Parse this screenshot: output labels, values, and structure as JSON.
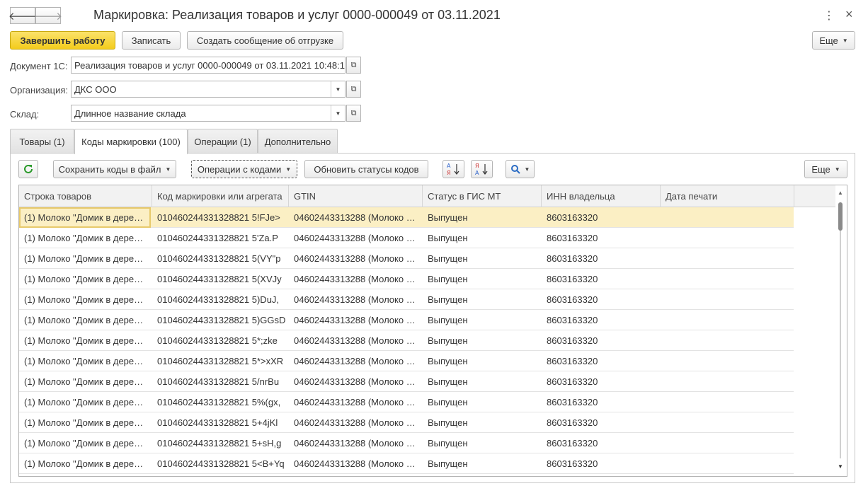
{
  "window": {
    "title": "Маркировка: Реализация товаров и услуг 0000-000049 от 03.11.2021",
    "back_icon": "back-arrow-icon",
    "forward_icon": "forward-arrow-icon",
    "menu_icon": "more-vertical-icon",
    "close_icon": "close-icon",
    "close_glyph": "×",
    "menu_glyph": "⋮"
  },
  "toolbar": {
    "finish_label": "Завершить работу",
    "save_label": "Записать",
    "create_message_label": "Создать сообщение об отгрузке",
    "more_label": "Еще"
  },
  "form": {
    "document_label": "Документ 1С:",
    "document_value": "Реализация товаров и услуг 0000-000049 от 03.11.2021 10:48:11",
    "organization_label": "Организация:",
    "organization_value": "ДКС ООО",
    "warehouse_label": "Склад:",
    "warehouse_value": "Длинное название склада"
  },
  "tabs": [
    {
      "label": "Товары (1)"
    },
    {
      "label": "Коды маркировки (100)"
    },
    {
      "label": "Операции (1)"
    },
    {
      "label": "Дополнительно"
    }
  ],
  "codes_toolbar": {
    "save_codes_label": "Сохранить коды в файл",
    "operations_label": "Операции с кодами",
    "update_statuses_label": "Обновить статусы кодов",
    "more_label": "Еще"
  },
  "table": {
    "columns": [
      "Строка товаров",
      "Код маркировки или агрегата",
      "GTIN",
      "Статус в ГИС МТ",
      "ИНН владельца",
      "Дата печати"
    ],
    "rows": [
      [
        "(1) Молоко \"Домик в дере…",
        "010460244331328821 5!FJe>",
        "04602443313288 (Молоко …",
        "Выпущен",
        "8603163320",
        ""
      ],
      [
        "(1) Молоко \"Домик в дере…",
        "010460244331328821 5'Za.P",
        "04602443313288 (Молоко …",
        "Выпущен",
        "8603163320",
        ""
      ],
      [
        "(1) Молоко \"Домик в дере…",
        "010460244331328821 5(VY\"p",
        "04602443313288 (Молоко …",
        "Выпущен",
        "8603163320",
        ""
      ],
      [
        "(1) Молоко \"Домик в дере…",
        "010460244331328821 5(XVJy",
        "04602443313288 (Молоко …",
        "Выпущен",
        "8603163320",
        ""
      ],
      [
        "(1) Молоко \"Домик в дере…",
        "010460244331328821 5)DuJ,",
        "04602443313288 (Молоко …",
        "Выпущен",
        "8603163320",
        ""
      ],
      [
        "(1) Молоко \"Домик в дере…",
        "010460244331328821 5)GGsD",
        "04602443313288 (Молоко …",
        "Выпущен",
        "8603163320",
        ""
      ],
      [
        "(1) Молоко \"Домик в дере…",
        "010460244331328821 5*;zke",
        "04602443313288 (Молоко …",
        "Выпущен",
        "8603163320",
        ""
      ],
      [
        "(1) Молоко \"Домик в дере…",
        "010460244331328821 5*>xXR",
        "04602443313288 (Молоко …",
        "Выпущен",
        "8603163320",
        ""
      ],
      [
        "(1) Молоко \"Домик в дере…",
        "010460244331328821 5/nrBu",
        "04602443313288 (Молоко …",
        "Выпущен",
        "8603163320",
        ""
      ],
      [
        "(1) Молоко \"Домик в дере…",
        "010460244331328821 5%(gx,",
        "04602443313288 (Молоко …",
        "Выпущен",
        "8603163320",
        ""
      ],
      [
        "(1) Молоко \"Домик в дере…",
        "010460244331328821 5+4jKl",
        "04602443313288 (Молоко …",
        "Выпущен",
        "8603163320",
        ""
      ],
      [
        "(1) Молоко \"Домик в дере…",
        "010460244331328821 5+sH,g",
        "04602443313288 (Молоко …",
        "Выпущен",
        "8603163320",
        ""
      ],
      [
        "(1) Молоко \"Домик в дере…",
        "010460244331328821 5<B+Yq",
        "04602443313288 (Молоко …",
        "Выпущен",
        "8603163320",
        ""
      ]
    ]
  }
}
